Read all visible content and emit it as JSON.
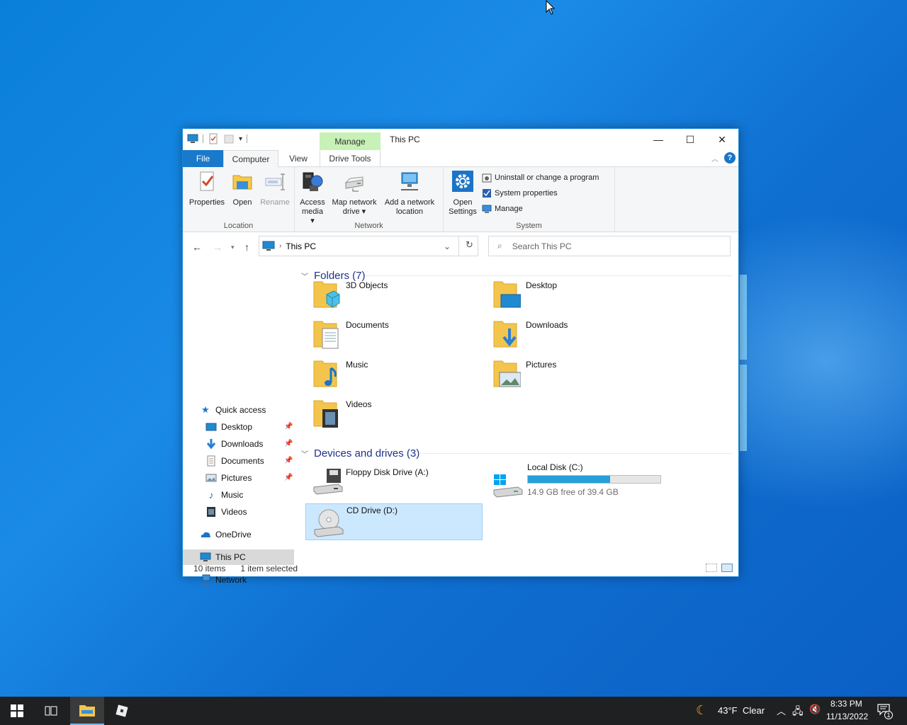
{
  "window": {
    "title": "This PC",
    "context_tab": "Manage",
    "minimize_glyph": "—",
    "maximize_glyph": "☐",
    "close_glyph": "✕"
  },
  "ribbon_tabs": {
    "file": "File",
    "computer": "Computer",
    "view": "View",
    "drive_tools": "Drive Tools"
  },
  "ribbon": {
    "location": {
      "label": "Location",
      "properties": "Properties",
      "open": "Open",
      "rename": "Rename"
    },
    "network": {
      "label": "Network",
      "access_media_1": "Access",
      "access_media_2": "media ▾",
      "map_drive_1": "Map network",
      "map_drive_2": "drive ▾",
      "add_location_1": "Add a network",
      "add_location_2": "location"
    },
    "system": {
      "label": "System",
      "open_settings_1": "Open",
      "open_settings_2": "Settings",
      "uninstall": "Uninstall or change a program",
      "system_properties": "System properties",
      "manage": "Manage"
    }
  },
  "address": {
    "path": "This PC",
    "search_placeholder": "Search This PC"
  },
  "nav": {
    "quick_access": "Quick access",
    "items": [
      "Desktop",
      "Downloads",
      "Documents",
      "Pictures",
      "Music",
      "Videos"
    ],
    "onedrive": "OneDrive",
    "this_pc": "This PC",
    "network": "Network"
  },
  "content": {
    "folders_header": "Folders (7)",
    "folders": [
      "3D Objects",
      "Desktop",
      "Documents",
      "Downloads",
      "Music",
      "Pictures",
      "Videos"
    ],
    "devices_header": "Devices and drives (3)",
    "floppy": "Floppy Disk Drive (A:)",
    "local_disk": "Local Disk (C:)",
    "local_disk_free": "14.9 GB free of 39.4 GB",
    "local_disk_used_fraction": 0.62,
    "cd_drive": "CD Drive (D:)"
  },
  "status": {
    "items": "10 items",
    "selected": "1 item selected"
  },
  "taskbar": {
    "weather_temp": "43°F",
    "weather_text": "Clear",
    "time": "8:33 PM",
    "date": "11/13/2022",
    "notification_count": "1"
  }
}
